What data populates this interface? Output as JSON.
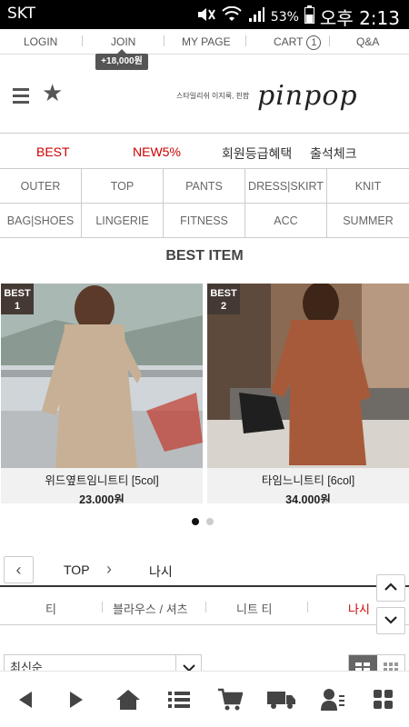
{
  "status": {
    "carrier": "SKT",
    "battery": "53%",
    "clock": "오후 2:13"
  },
  "topnav": {
    "login": "LOGIN",
    "join": "JOIN",
    "mypage": "MY PAGE",
    "cart": "CART",
    "cart_count": "1",
    "qa": "Q&A",
    "join_tip": "+18,000원"
  },
  "header": {
    "tagline": "스타일리쉬 이지룩, 핀팝",
    "logo": "pinpop"
  },
  "tabs": [
    "BEST",
    "NEW5%",
    "회원등급혜택",
    "출석체크"
  ],
  "categories": [
    [
      "OUTER",
      "TOP",
      "PANTS",
      "DRESS|SKIRT",
      "KNIT"
    ],
    [
      "BAG|SHOES",
      "LINGERIE",
      "FITNESS",
      "ACC",
      "SUMMER"
    ]
  ],
  "best": {
    "title": "BEST ITEM",
    "items": [
      {
        "badge_top": "BEST",
        "badge_num": "1",
        "name": "위드옆트임니트티 [5col]",
        "price": "23,000원"
      },
      {
        "badge_top": "BEST",
        "badge_num": "2",
        "name": "타임느니트티 [6col]",
        "price": "34,000원"
      }
    ]
  },
  "breadcrumb": {
    "parent": "TOP",
    "current": "나시"
  },
  "subcats": [
    "티",
    "블라우스 / 셔츠",
    "니트 티",
    "나시"
  ],
  "sort": {
    "value": "최신순"
  },
  "colors": {
    "accent": "#cc0000",
    "badge": "#443a33"
  }
}
